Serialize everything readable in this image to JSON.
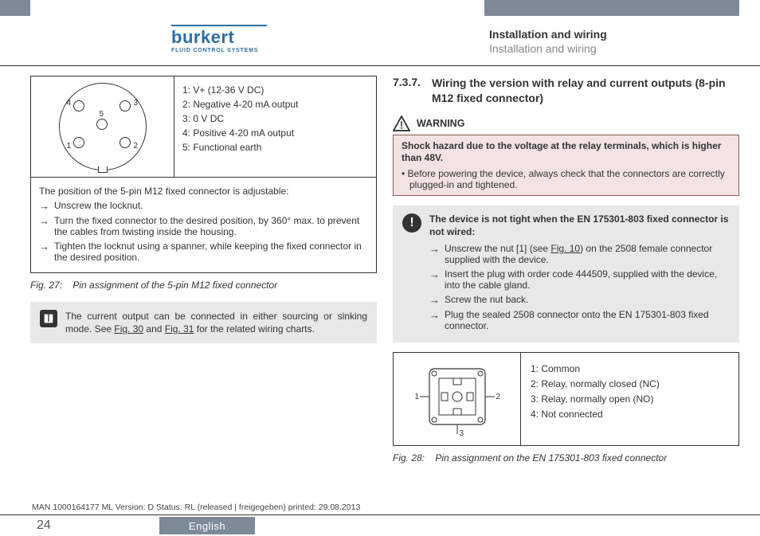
{
  "header": {
    "logo_name": "burkert",
    "logo_tagline": "FLUID CONTROL SYSTEMS",
    "title_bold": "Installation and wiring",
    "title_light": "Installation and wiring"
  },
  "left": {
    "pins": {
      "p1": "1: V+ (12-36 V DC)",
      "p2": "2: Negative 4-20 mA output",
      "p3": "3: 0 V DC",
      "p4": "4: Positive 4-20 mA output",
      "p5": "5: Functional earth"
    },
    "pinnum": {
      "n1": "1",
      "n2": "2",
      "n3": "3",
      "n4": "4",
      "n5": "5"
    },
    "adjust_intro": "The position of the 5-pin M12 fixed connector is adjustable:",
    "step1": "Unscrew the locknut.",
    "step2": "Turn the fixed connector to the desired position, by 360° max. to prevent the cables from twisting inside the housing.",
    "step3": "Tighten the locknut using a spanner, while keeping the fixed connector in the desired position.",
    "fig_num": "Fig. 27:",
    "fig_text": "Pin assignment of the 5-pin M12 fixed connector",
    "info_text_a": "The current output can be connected in either sourcing or sinking mode. See ",
    "info_link1": "Fig. 30",
    "info_mid": " and ",
    "info_link2": "Fig. 31",
    "info_text_b": " for the related wiring charts."
  },
  "right": {
    "sec_num": "7.3.7.",
    "sec_title": "Wiring the version with relay and current outputs (8-pin M12 fixed connector)",
    "warn_label": "WARNING",
    "warn_title": "Shock hazard due to the voltage at the relay terminals, which is higher than 48V.",
    "warn_bullet": "Before powering the device, always check that the connectors are correctly plugged-in and tightened.",
    "notice_title": "The device is not tight when the EN 175301-803 fixed connector is not wired:",
    "n_step1a": "Unscrew the nut [1] (see ",
    "n_step1_link": "Fig. 10",
    "n_step1b": ") on the 2508 female connector supplied with the device.",
    "n_step2": "Insert the plug with order code 444509, supplied with the device, into the cable gland.",
    "n_step3": "Screw the nut back.",
    "n_step4": "Plug the sealed 2508 connector onto the EN 175301-803 fixed connector.",
    "pins2": {
      "p1": "1: Common",
      "p2": "2: Relay, normally closed (NC)",
      "p3": "3: Relay, normally open (NO)",
      "p4": "4: Not connected"
    },
    "pn2": {
      "n1": "1",
      "n2": "2",
      "n3": "3"
    },
    "fig_num": "Fig. 28:",
    "fig_text": "Pin assignment on the EN 175301-803 fixed connector"
  },
  "footer": {
    "meta": "MAN 1000164177 ML Version: D Status: RL (released | freigegeben) printed: 29.08.2013",
    "page": "24",
    "lang": "English"
  }
}
